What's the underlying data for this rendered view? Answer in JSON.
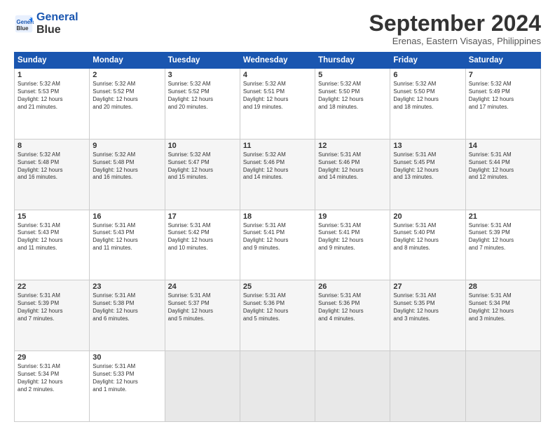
{
  "header": {
    "logo_line1": "General",
    "logo_line2": "Blue",
    "title": "September 2024",
    "location": "Erenas, Eastern Visayas, Philippines"
  },
  "weekdays": [
    "Sunday",
    "Monday",
    "Tuesday",
    "Wednesday",
    "Thursday",
    "Friday",
    "Saturday"
  ],
  "weeks": [
    [
      {
        "day": "1",
        "lines": [
          "Sunrise: 5:32 AM",
          "Sunset: 5:53 PM",
          "Daylight: 12 hours",
          "and 21 minutes."
        ]
      },
      {
        "day": "2",
        "lines": [
          "Sunrise: 5:32 AM",
          "Sunset: 5:52 PM",
          "Daylight: 12 hours",
          "and 20 minutes."
        ]
      },
      {
        "day": "3",
        "lines": [
          "Sunrise: 5:32 AM",
          "Sunset: 5:52 PM",
          "Daylight: 12 hours",
          "and 20 minutes."
        ]
      },
      {
        "day": "4",
        "lines": [
          "Sunrise: 5:32 AM",
          "Sunset: 5:51 PM",
          "Daylight: 12 hours",
          "and 19 minutes."
        ]
      },
      {
        "day": "5",
        "lines": [
          "Sunrise: 5:32 AM",
          "Sunset: 5:50 PM",
          "Daylight: 12 hours",
          "and 18 minutes."
        ]
      },
      {
        "day": "6",
        "lines": [
          "Sunrise: 5:32 AM",
          "Sunset: 5:50 PM",
          "Daylight: 12 hours",
          "and 18 minutes."
        ]
      },
      {
        "day": "7",
        "lines": [
          "Sunrise: 5:32 AM",
          "Sunset: 5:49 PM",
          "Daylight: 12 hours",
          "and 17 minutes."
        ]
      }
    ],
    [
      {
        "day": "8",
        "lines": [
          "Sunrise: 5:32 AM",
          "Sunset: 5:48 PM",
          "Daylight: 12 hours",
          "and 16 minutes."
        ]
      },
      {
        "day": "9",
        "lines": [
          "Sunrise: 5:32 AM",
          "Sunset: 5:48 PM",
          "Daylight: 12 hours",
          "and 16 minutes."
        ]
      },
      {
        "day": "10",
        "lines": [
          "Sunrise: 5:32 AM",
          "Sunset: 5:47 PM",
          "Daylight: 12 hours",
          "and 15 minutes."
        ]
      },
      {
        "day": "11",
        "lines": [
          "Sunrise: 5:32 AM",
          "Sunset: 5:46 PM",
          "Daylight: 12 hours",
          "and 14 minutes."
        ]
      },
      {
        "day": "12",
        "lines": [
          "Sunrise: 5:31 AM",
          "Sunset: 5:46 PM",
          "Daylight: 12 hours",
          "and 14 minutes."
        ]
      },
      {
        "day": "13",
        "lines": [
          "Sunrise: 5:31 AM",
          "Sunset: 5:45 PM",
          "Daylight: 12 hours",
          "and 13 minutes."
        ]
      },
      {
        "day": "14",
        "lines": [
          "Sunrise: 5:31 AM",
          "Sunset: 5:44 PM",
          "Daylight: 12 hours",
          "and 12 minutes."
        ]
      }
    ],
    [
      {
        "day": "15",
        "lines": [
          "Sunrise: 5:31 AM",
          "Sunset: 5:43 PM",
          "Daylight: 12 hours",
          "and 11 minutes."
        ]
      },
      {
        "day": "16",
        "lines": [
          "Sunrise: 5:31 AM",
          "Sunset: 5:43 PM",
          "Daylight: 12 hours",
          "and 11 minutes."
        ]
      },
      {
        "day": "17",
        "lines": [
          "Sunrise: 5:31 AM",
          "Sunset: 5:42 PM",
          "Daylight: 12 hours",
          "and 10 minutes."
        ]
      },
      {
        "day": "18",
        "lines": [
          "Sunrise: 5:31 AM",
          "Sunset: 5:41 PM",
          "Daylight: 12 hours",
          "and 9 minutes."
        ]
      },
      {
        "day": "19",
        "lines": [
          "Sunrise: 5:31 AM",
          "Sunset: 5:41 PM",
          "Daylight: 12 hours",
          "and 9 minutes."
        ]
      },
      {
        "day": "20",
        "lines": [
          "Sunrise: 5:31 AM",
          "Sunset: 5:40 PM",
          "Daylight: 12 hours",
          "and 8 minutes."
        ]
      },
      {
        "day": "21",
        "lines": [
          "Sunrise: 5:31 AM",
          "Sunset: 5:39 PM",
          "Daylight: 12 hours",
          "and 7 minutes."
        ]
      }
    ],
    [
      {
        "day": "22",
        "lines": [
          "Sunrise: 5:31 AM",
          "Sunset: 5:39 PM",
          "Daylight: 12 hours",
          "and 7 minutes."
        ]
      },
      {
        "day": "23",
        "lines": [
          "Sunrise: 5:31 AM",
          "Sunset: 5:38 PM",
          "Daylight: 12 hours",
          "and 6 minutes."
        ]
      },
      {
        "day": "24",
        "lines": [
          "Sunrise: 5:31 AM",
          "Sunset: 5:37 PM",
          "Daylight: 12 hours",
          "and 5 minutes."
        ]
      },
      {
        "day": "25",
        "lines": [
          "Sunrise: 5:31 AM",
          "Sunset: 5:36 PM",
          "Daylight: 12 hours",
          "and 5 minutes."
        ]
      },
      {
        "day": "26",
        "lines": [
          "Sunrise: 5:31 AM",
          "Sunset: 5:36 PM",
          "Daylight: 12 hours",
          "and 4 minutes."
        ]
      },
      {
        "day": "27",
        "lines": [
          "Sunrise: 5:31 AM",
          "Sunset: 5:35 PM",
          "Daylight: 12 hours",
          "and 3 minutes."
        ]
      },
      {
        "day": "28",
        "lines": [
          "Sunrise: 5:31 AM",
          "Sunset: 5:34 PM",
          "Daylight: 12 hours",
          "and 3 minutes."
        ]
      }
    ],
    [
      {
        "day": "29",
        "lines": [
          "Sunrise: 5:31 AM",
          "Sunset: 5:34 PM",
          "Daylight: 12 hours",
          "and 2 minutes."
        ]
      },
      {
        "day": "30",
        "lines": [
          "Sunrise: 5:31 AM",
          "Sunset: 5:33 PM",
          "Daylight: 12 hours",
          "and 1 minute."
        ]
      },
      {
        "day": "",
        "lines": []
      },
      {
        "day": "",
        "lines": []
      },
      {
        "day": "",
        "lines": []
      },
      {
        "day": "",
        "lines": []
      },
      {
        "day": "",
        "lines": []
      }
    ]
  ]
}
